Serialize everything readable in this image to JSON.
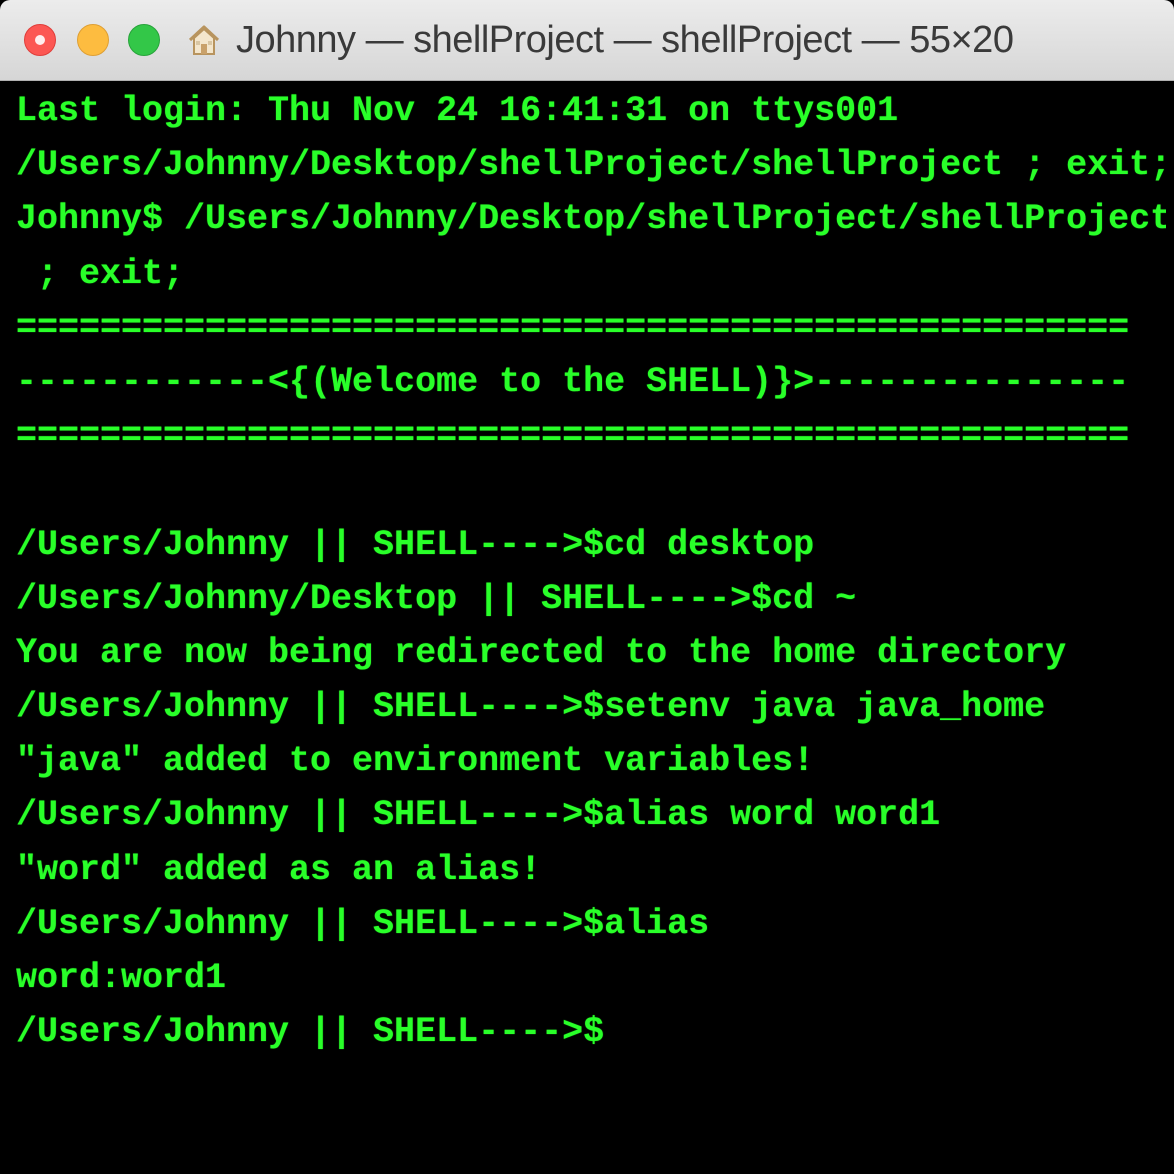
{
  "window": {
    "title": "Johnny — shellProject — shellProject — 55×20",
    "icon": "home-folder-icon"
  },
  "colors": {
    "terminal_background": "#000000",
    "terminal_text": "#29ff29"
  },
  "terminal": {
    "lines": [
      "Last login: Thu Nov 24 16:41:31 on ttys001",
      "/Users/Johnny/Desktop/shellProject/shellProject ; exit;",
      "Johnny$ /Users/Johnny/Desktop/shellProject/shellProject",
      " ; exit;",
      "=====================================================",
      "------------<{(Welcome to the SHELL)}>---------------",
      "=====================================================",
      "",
      "/Users/Johnny || SHELL---->$cd desktop",
      "/Users/Johnny/Desktop || SHELL---->$cd ~",
      "You are now being redirected to the home directory",
      "/Users/Johnny || SHELL---->$setenv java java_home",
      "\"java\" added to environment variables!",
      "/Users/Johnny || SHELL---->$alias word word1",
      "\"word\" added as an alias!",
      "/Users/Johnny || SHELL---->$alias",
      "word:word1",
      "/Users/Johnny || SHELL---->$"
    ]
  }
}
